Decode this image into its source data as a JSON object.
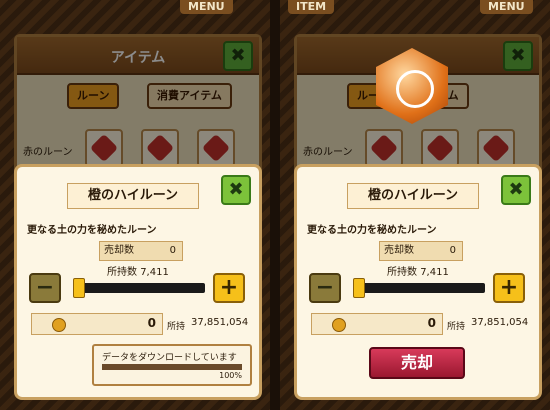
{
  "left": {
    "item_window": {
      "title": "アイテム",
      "tab_rune": "ルーン",
      "tab_consume": "消費アイテム",
      "rune_label": "赤のルーン"
    },
    "dialog": {
      "title": "橙のハイルーン",
      "desc": "更なる土の力を秘めたルーン",
      "sell_count_label": "売却数",
      "sell_count": "0",
      "owned_label": "所持数",
      "owned_count": "7,411",
      "gold_value": "0",
      "held_label": "所持",
      "held_value": "37,851,054"
    },
    "download": {
      "text": "データをダウンロードしています",
      "percent": "100%",
      "progress": 1.0
    }
  },
  "right": {
    "item_window": {
      "title": "",
      "tab_rune": "ルー",
      "tab_consume": "テム",
      "rune_label": "赤のルーン"
    },
    "dialog": {
      "title": "橙のハイルーン",
      "desc": "更なる土の力を秘めたルーン",
      "sell_count_label": "売却数",
      "sell_count": "0",
      "owned_label": "所持数",
      "owned_count": "7,411",
      "gold_value": "0",
      "held_label": "所持",
      "held_value": "37,851,054",
      "sell_button": "売却"
    }
  },
  "topbar": {
    "item": "ITEM",
    "menu": "MENU"
  },
  "icons": {
    "close": "close-x-icon",
    "minus": "minus-icon",
    "plus": "plus-icon",
    "coin": "coin-icon",
    "gem": "rune-gem-icon"
  },
  "colors": {
    "accent_green": "#7cc23a",
    "gold": "#f6c01a",
    "sell_red": "#c0283e"
  }
}
